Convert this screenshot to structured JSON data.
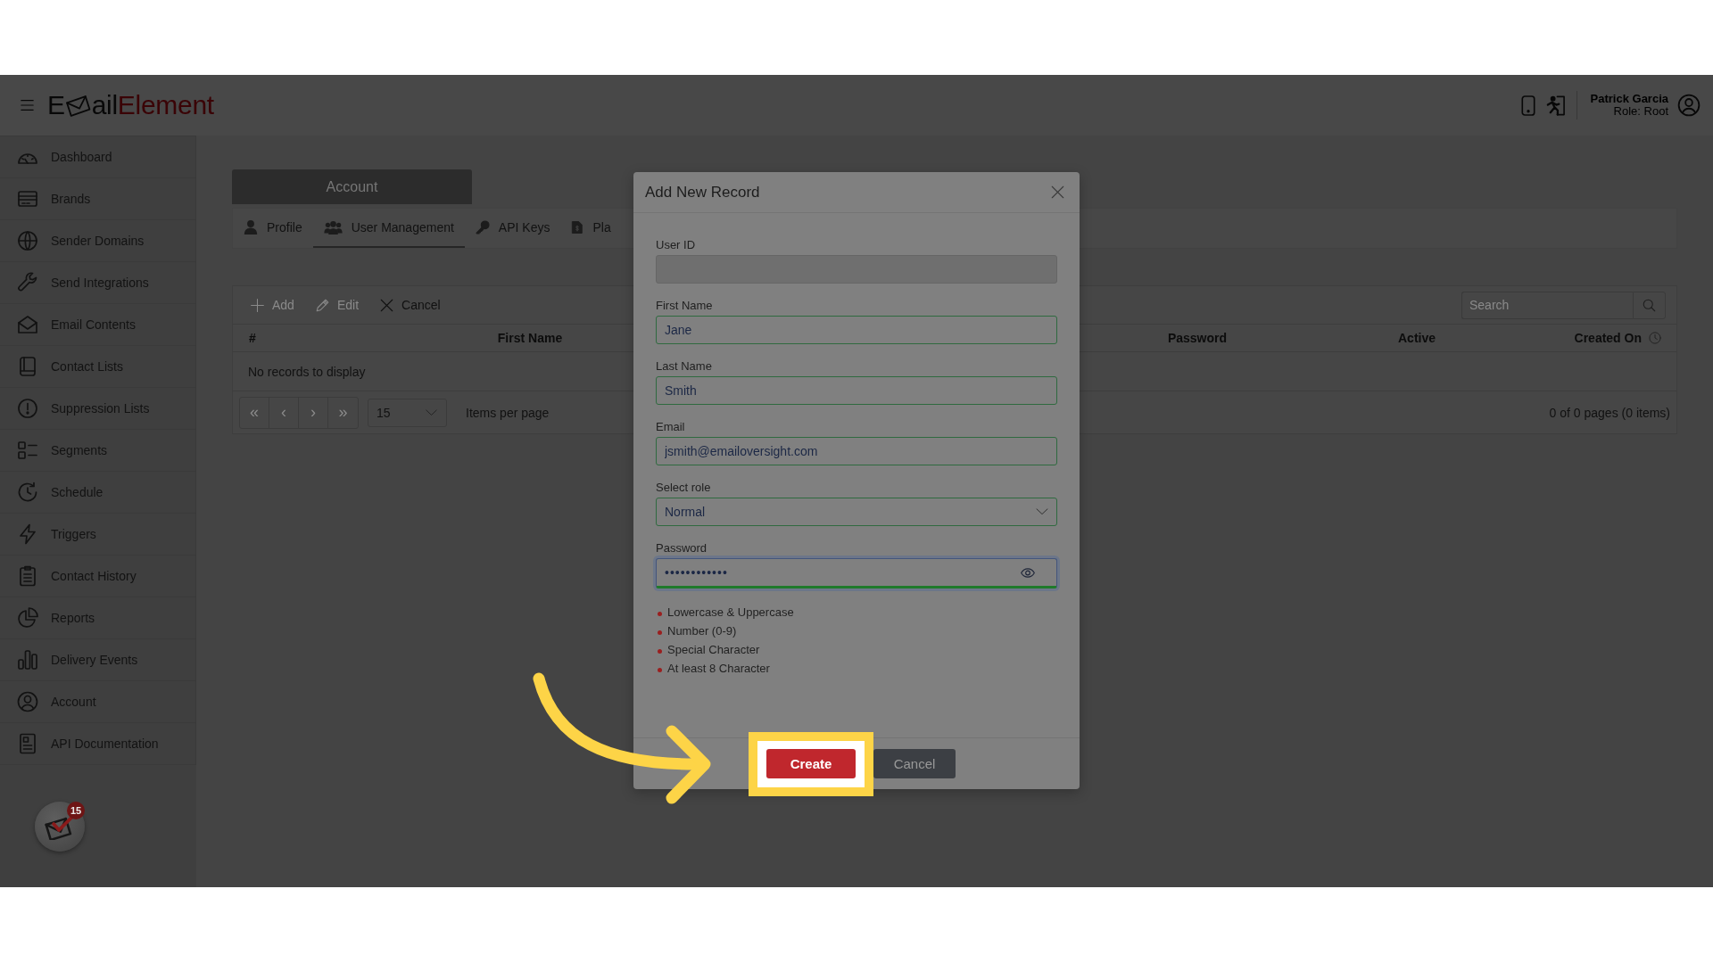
{
  "header": {
    "logo": {
      "first": "E",
      "rest": "ail",
      "accent": "Element"
    },
    "user": {
      "name": "Patrick Garcia",
      "role": "Role: Root"
    }
  },
  "sidebar": {
    "items": [
      {
        "label": "Dashboard",
        "selected": false
      },
      {
        "label": "Brands",
        "selected": false
      },
      {
        "label": "Sender Domains",
        "selected": false
      },
      {
        "label": "Send Integrations",
        "selected": false
      },
      {
        "label": "Email Contents",
        "selected": false
      },
      {
        "label": "Contact Lists",
        "selected": false
      },
      {
        "label": "Suppression Lists",
        "selected": false
      },
      {
        "label": "Segments",
        "selected": false
      },
      {
        "label": "Schedule",
        "selected": false
      },
      {
        "label": "Triggers",
        "selected": false
      },
      {
        "label": "Contact History",
        "selected": false
      },
      {
        "label": "Reports",
        "selected": false
      },
      {
        "label": "Delivery Events",
        "selected": false
      },
      {
        "label": "Account",
        "selected": false
      },
      {
        "label": "API Documentation",
        "selected": false
      }
    ],
    "notification_count": "15"
  },
  "account": {
    "title": "Account",
    "tabs": [
      {
        "label": "Profile",
        "selected": false
      },
      {
        "label": "User Management",
        "selected": true
      },
      {
        "label": "API Keys",
        "selected": false
      },
      {
        "label": "Pla",
        "selected": false
      }
    ],
    "toolbar": [
      {
        "label": "Add",
        "disabled": true
      },
      {
        "label": "Edit",
        "disabled": true
      },
      {
        "label": "Cancel",
        "disabled": false
      }
    ],
    "search": {
      "placeholder": "Search"
    },
    "table": {
      "columns": [
        "#",
        "First Name",
        "Password",
        "Active",
        "Created On"
      ],
      "empty_message": "No records to display"
    },
    "pager": {
      "buttons": [
        {
          "label": "«",
          "disabled": true
        },
        {
          "label": "‹",
          "disabled": true
        },
        {
          "label": "›",
          "disabled": true
        },
        {
          "label": "»",
          "disabled": true
        }
      ],
      "page_size": "15",
      "page_size_label": "Items per page",
      "summary": "0 of 0 pages (0 items)"
    }
  },
  "modal": {
    "title": "Add New Record",
    "fields": [
      {
        "kind": "text",
        "label": "User ID",
        "disabled": true,
        "valid": false,
        "focused": false
      },
      {
        "kind": "text",
        "label": "First Name",
        "value": "Jane",
        "disabled": false,
        "valid": true,
        "focused": false
      },
      {
        "kind": "text",
        "label": "Last Name",
        "value": "Smith",
        "disabled": false,
        "valid": true,
        "focused": false
      },
      {
        "kind": "text",
        "label": "Email",
        "value": "jsmith@emailoversight.com",
        "disabled": false,
        "valid": true,
        "focused": false
      },
      {
        "kind": "select",
        "label": "Select role",
        "value": "Normal",
        "disabled": false,
        "valid": true,
        "focused": false
      },
      {
        "kind": "password",
        "label": "Password",
        "value": "••••••••••••",
        "disabled": false,
        "valid": true,
        "focused": true
      }
    ],
    "password_rules": [
      {
        "text": "Lowercase & Uppercase",
        "met": false
      },
      {
        "text": "Number (0-9)",
        "met": false
      },
      {
        "text": "Special Character",
        "met": false
      },
      {
        "text": "At least 8 Character",
        "met": false
      }
    ],
    "buttons": [
      {
        "kind": "primary",
        "label": "Create",
        "highlighted": true
      },
      {
        "kind": "secondary",
        "label": "Cancel",
        "highlighted": false
      }
    ]
  }
}
